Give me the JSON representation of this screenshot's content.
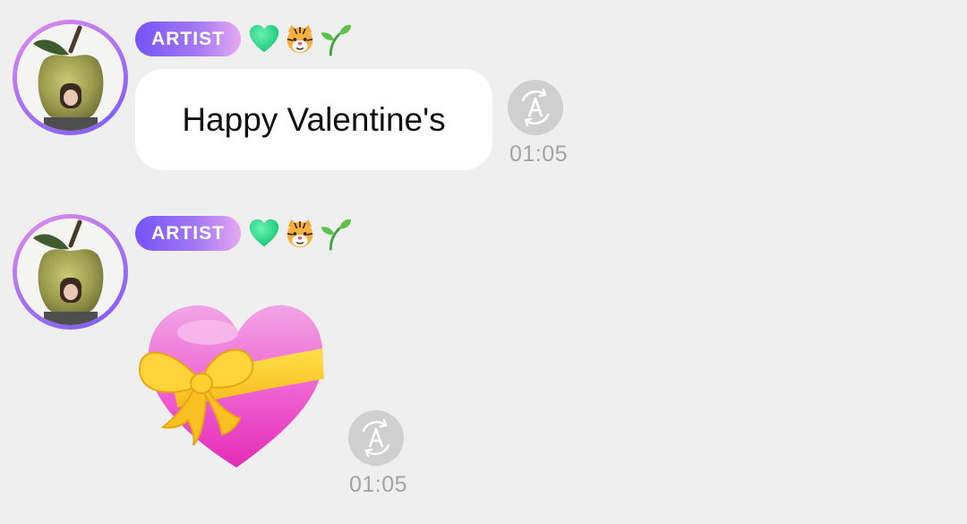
{
  "messages": [
    {
      "badge": "ARTIST",
      "emojis": [
        "green-heart-icon",
        "tiger-face-icon",
        "seedling-icon"
      ],
      "text": "Happy Valentine's",
      "translate_icon": "translate-icon",
      "time": "01:05"
    },
    {
      "badge": "ARTIST",
      "emojis": [
        "green-heart-icon",
        "tiger-face-icon",
        "seedling-icon"
      ],
      "sticker": "heart-with-ribbon-icon",
      "translate_icon": "translate-icon",
      "time": "01:05"
    }
  ],
  "colors": {
    "background": "#efefef",
    "badge_gradient_start": "#7553f6",
    "badge_gradient_end": "#e6a8f2",
    "bubble": "#ffffff",
    "timestamp": "#a3a3a3"
  }
}
